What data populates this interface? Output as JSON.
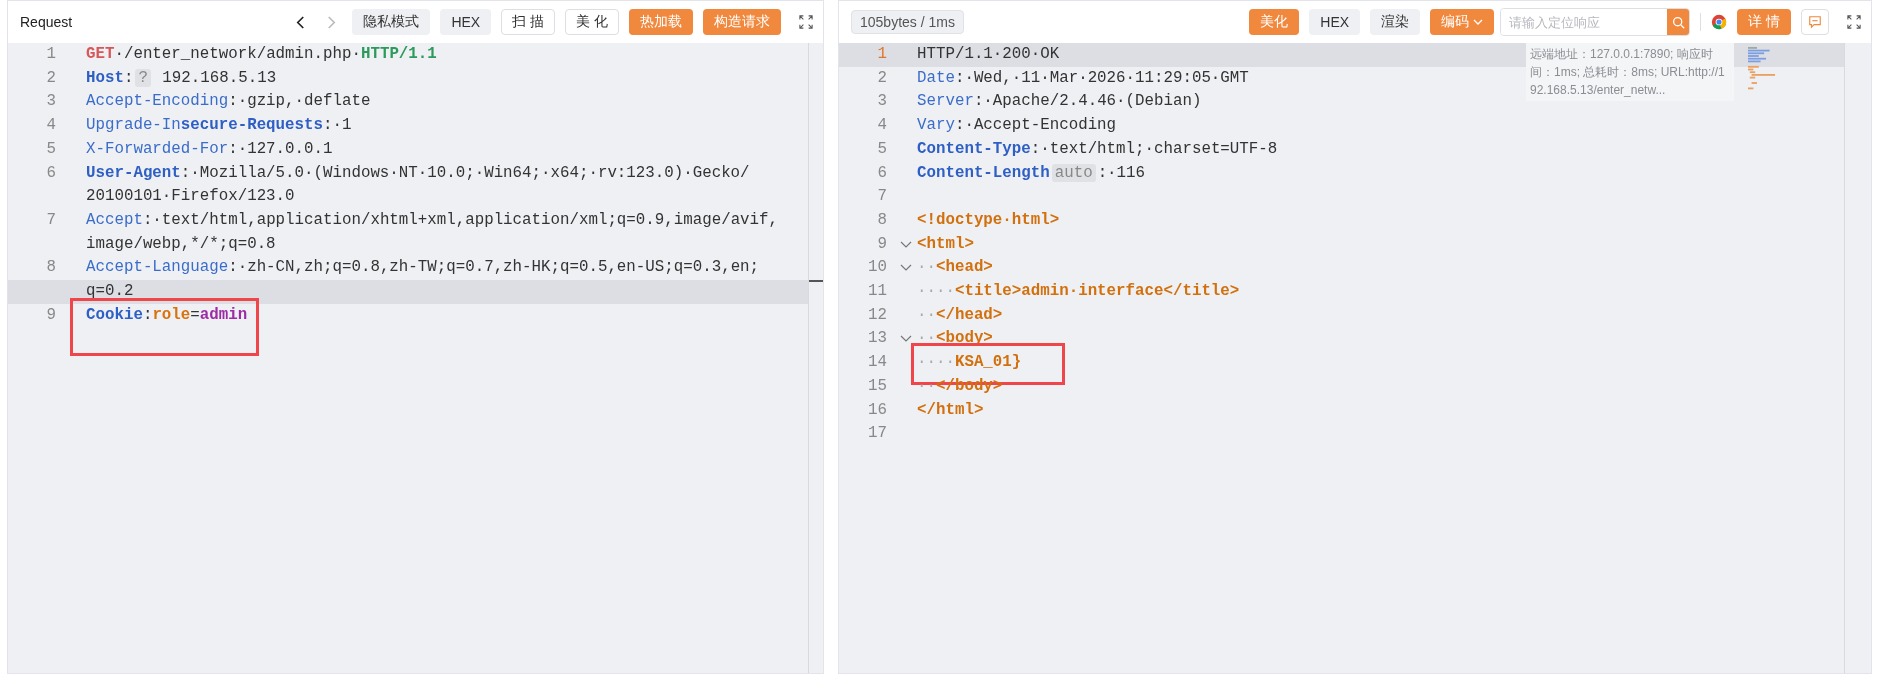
{
  "request": {
    "title": "Request",
    "focused": false,
    "nav": [
      {
        "kind": "back",
        "disabled": false
      },
      {
        "kind": "forward",
        "disabled": true
      }
    ],
    "buttons": [
      {
        "label": "隐私模式",
        "kind": "gray"
      },
      {
        "label": "HEX",
        "kind": "gray"
      },
      {
        "label": "扫 描",
        "kind": "outline"
      },
      {
        "label": "美 化",
        "kind": "outline"
      },
      {
        "label": "热加载",
        "kind": "orange"
      },
      {
        "label": "构造请求",
        "kind": "orange"
      }
    ],
    "lines": [
      {
        "number": "1",
        "active": false,
        "highlighted": false,
        "foldable": false,
        "rows": [
          [
            {
              "kind": "method",
              "text": "GET"
            },
            {
              "kind": "plain",
              "text": "·/enter_network/admin.php·"
            },
            {
              "kind": "version",
              "text": "HTTP/1.1"
            }
          ]
        ]
      },
      {
        "number": "2",
        "active": false,
        "highlighted": false,
        "foldable": false,
        "rows": [
          [
            {
              "kind": "key-bold",
              "text": "Host"
            },
            {
              "kind": "plain",
              "text": ":"
            },
            {
              "kind": "badge",
              "text": "?"
            },
            {
              "kind": "plain",
              "text": " 192.168.5.13"
            }
          ]
        ]
      },
      {
        "number": "3",
        "active": false,
        "highlighted": false,
        "foldable": false,
        "rows": [
          [
            {
              "kind": "key",
              "text": "Accept-Encoding"
            },
            {
              "kind": "plain",
              "text": ":·gzip,·deflate"
            }
          ]
        ]
      },
      {
        "number": "4",
        "active": false,
        "highlighted": false,
        "foldable": false,
        "rows": [
          [
            {
              "kind": "key",
              "text": "Upgrade-In"
            },
            {
              "kind": "key-bold",
              "text": "secure-Requests"
            },
            {
              "kind": "plain",
              "text": ":·1"
            }
          ]
        ]
      },
      {
        "number": "5",
        "active": false,
        "highlighted": false,
        "foldable": false,
        "rows": [
          [
            {
              "kind": "key",
              "text": "X-Forwarded-For"
            },
            {
              "kind": "plain",
              "text": ":·127.0.0.1"
            }
          ]
        ]
      },
      {
        "number": "6",
        "active": false,
        "highlighted": false,
        "foldable": false,
        "rows": [
          [
            {
              "kind": "key-bold",
              "text": "User-Agent"
            },
            {
              "kind": "plain",
              "text": ":·Mozilla/5.0·(Windows·NT·10.0;·Win64;·x64;·rv:123.0)·Gecko/"
            }
          ],
          [
            {
              "kind": "plain",
              "text": "20100101·Firefox/123.0"
            }
          ]
        ]
      },
      {
        "number": "7",
        "active": false,
        "highlighted": false,
        "foldable": false,
        "rows": [
          [
            {
              "kind": "key",
              "text": "Accept"
            },
            {
              "kind": "plain",
              "text": ":·text/html,application/xhtml+xml,application/xml;q=0.9,image/avif,"
            }
          ],
          [
            {
              "kind": "plain",
              "text": "image/webp,*/*;q=0.8"
            }
          ]
        ]
      },
      {
        "number": "8",
        "active": true,
        "highlighted": false,
        "foldable": false,
        "rows": [
          [
            {
              "kind": "key",
              "text": "Accept-Language"
            },
            {
              "kind": "plain",
              "text": ":·zh-CN,zh;q=0.8,zh-TW;q=0.7,zh-HK;q=0.5,en-US;q=0.3,en;"
            }
          ],
          [
            {
              "kind": "plain",
              "text": "q=0.2"
            }
          ]
        ]
      },
      {
        "number": "9",
        "active": false,
        "highlighted": true,
        "foldable": false,
        "rows": [
          [
            {
              "kind": "key-bold",
              "text": "Cookie"
            },
            {
              "kind": "plain",
              "text": ":"
            },
            {
              "kind": "cookie-name",
              "text": "role"
            },
            {
              "kind": "plain",
              "text": "="
            },
            {
              "kind": "cookie-value",
              "text": "admin"
            }
          ]
        ]
      }
    ]
  },
  "response": {
    "stats": "105bytes / 1ms",
    "focused": true,
    "buttons": [
      {
        "label": "美化",
        "kind": "orange"
      },
      {
        "label": "HEX",
        "kind": "gray"
      },
      {
        "label": "渲染",
        "kind": "gray"
      },
      {
        "label": "编码",
        "kind": "dropdown"
      }
    ],
    "search": {
      "placeholder": "请输入定位响应"
    },
    "detail_button": "详 情",
    "info": "远端地址：127.0.0.1:7890; 响应时间：1ms; 总耗时：8ms; URL:http://192.168.5.13/enter_netw...",
    "lines": [
      {
        "number": "1",
        "active": true,
        "highlighted": false,
        "foldable": false,
        "rows": [
          [
            {
              "kind": "plain",
              "text": "HTTP/1.1·200·OK"
            }
          ]
        ]
      },
      {
        "number": "2",
        "active": false,
        "highlighted": false,
        "foldable": false,
        "rows": [
          [
            {
              "kind": "key",
              "text": "Date"
            },
            {
              "kind": "plain",
              "text": ":·Wed,·11·Mar·2026·11:29:05·GMT"
            }
          ]
        ]
      },
      {
        "number": "3",
        "active": false,
        "highlighted": false,
        "foldable": false,
        "rows": [
          [
            {
              "kind": "key",
              "text": "Server"
            },
            {
              "kind": "plain",
              "text": ":·Apache/2.4.46·(Debian)"
            }
          ]
        ]
      },
      {
        "number": "4",
        "active": false,
        "highlighted": false,
        "foldable": false,
        "rows": [
          [
            {
              "kind": "key",
              "text": "Vary"
            },
            {
              "kind": "plain",
              "text": ":·Accept-Encoding"
            }
          ]
        ]
      },
      {
        "number": "5",
        "active": false,
        "highlighted": false,
        "foldable": false,
        "rows": [
          [
            {
              "kind": "key-bold",
              "text": "Content-Type"
            },
            {
              "kind": "plain",
              "text": ":·text/html;·charset=UTF-8"
            }
          ]
        ]
      },
      {
        "number": "6",
        "active": false,
        "highlighted": false,
        "foldable": false,
        "rows": [
          [
            {
              "kind": "key-bold",
              "text": "Content-Length"
            },
            {
              "kind": "badge",
              "text": "auto"
            },
            {
              "kind": "plain",
              "text": ":·116"
            }
          ]
        ]
      },
      {
        "number": "7",
        "active": false,
        "highlighted": false,
        "foldable": false,
        "rows": [
          []
        ]
      },
      {
        "number": "8",
        "active": false,
        "highlighted": false,
        "foldable": false,
        "rows": [
          [
            {
              "kind": "tag",
              "text": "<!doctype·html>"
            }
          ]
        ]
      },
      {
        "number": "9",
        "active": false,
        "highlighted": false,
        "foldable": true,
        "rows": [
          [
            {
              "kind": "tag",
              "text": "<html>"
            }
          ]
        ]
      },
      {
        "number": "10",
        "active": false,
        "highlighted": false,
        "foldable": true,
        "rows": [
          [
            {
              "kind": "guide",
              "text": "··"
            },
            {
              "kind": "tag",
              "text": "<head>"
            }
          ]
        ]
      },
      {
        "number": "11",
        "active": false,
        "highlighted": false,
        "foldable": false,
        "rows": [
          [
            {
              "kind": "guide",
              "text": "····"
            },
            {
              "kind": "tag",
              "text": "<title>admin·interface</title>"
            }
          ]
        ]
      },
      {
        "number": "12",
        "active": false,
        "highlighted": false,
        "foldable": false,
        "rows": [
          [
            {
              "kind": "guide",
              "text": "··"
            },
            {
              "kind": "tag",
              "text": "</head>"
            }
          ]
        ]
      },
      {
        "number": "13",
        "active": false,
        "highlighted": false,
        "foldable": true,
        "rows": [
          [
            {
              "kind": "guide",
              "text": "··"
            },
            {
              "kind": "tag",
              "text": "<body>"
            }
          ]
        ]
      },
      {
        "number": "14",
        "active": false,
        "highlighted": true,
        "foldable": false,
        "rows": [
          [
            {
              "kind": "guide",
              "text": "····"
            },
            {
              "kind": "tag",
              "text": "KSA_01}"
            }
          ]
        ]
      },
      {
        "number": "15",
        "active": false,
        "highlighted": false,
        "foldable": false,
        "rows": [
          [
            {
              "kind": "guide",
              "text": "··"
            },
            {
              "kind": "tag",
              "text": "</body>"
            }
          ]
        ]
      },
      {
        "number": "16",
        "active": false,
        "highlighted": false,
        "foldable": false,
        "rows": [
          [
            {
              "kind": "tag",
              "text": "</html>"
            }
          ]
        ]
      },
      {
        "number": "17",
        "active": false,
        "highlighted": false,
        "foldable": false,
        "rows": [
          []
        ]
      }
    ]
  }
}
